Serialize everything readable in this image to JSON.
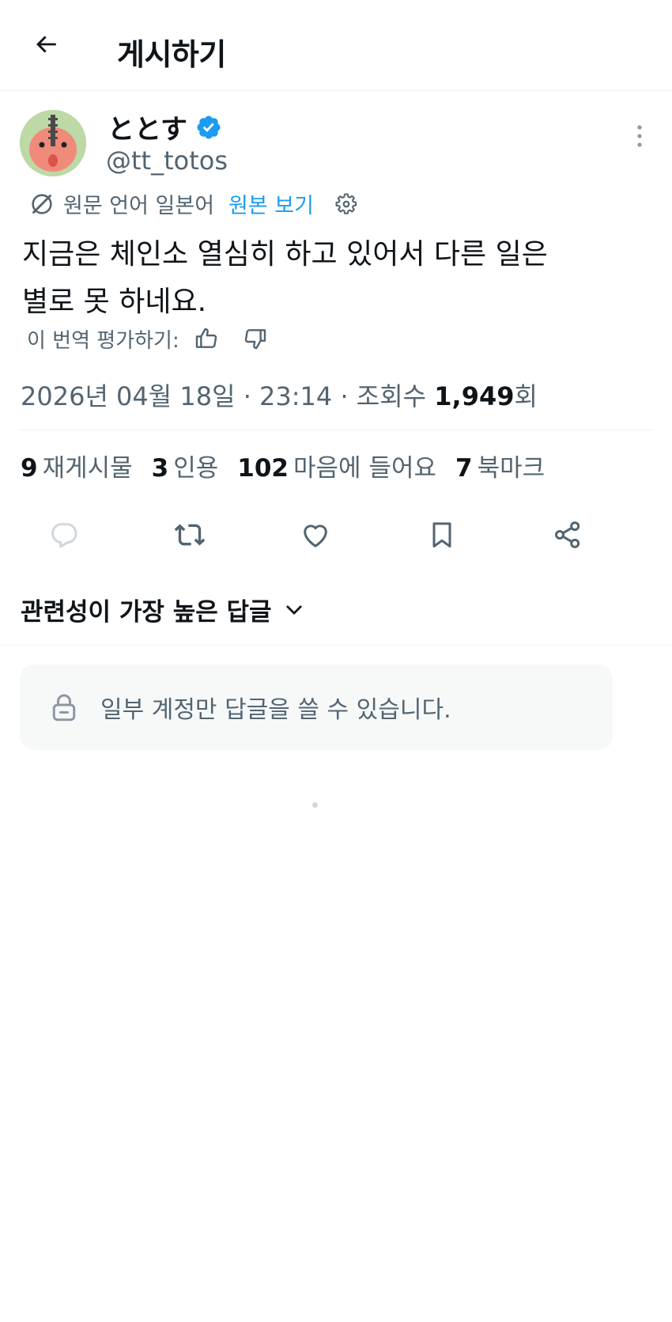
{
  "header": {
    "title": "게시하기",
    "back_icon": "arrow-left-icon"
  },
  "author": {
    "display_name": "ととす",
    "handle": "@tt_totos",
    "verified": true,
    "verified_color": "#1d9bf0"
  },
  "translation": {
    "source_label": "원문 언어 일본어",
    "view_original": "원본 보기",
    "rate_label": "이 번역 평가하기:"
  },
  "post": {
    "text_line1": "지금은 체인소 열심히 하고 있어서 다른 일은",
    "text_line2": "별로 못 하네요."
  },
  "meta": {
    "timestamp": "2026년 04월 18일 · 23:14 · 조회수 ",
    "views": "1,949",
    "views_suffix": "회"
  },
  "stats": [
    {
      "count": "9",
      "label": "재게시물"
    },
    {
      "count": "3",
      "label": "인용"
    },
    {
      "count": "102",
      "label": "마음에 들어요"
    },
    {
      "count": "7",
      "label": "북마크"
    }
  ],
  "replies": {
    "sort_label": "관련성이 가장 높은 답글",
    "restricted_message": "일부 계정만 답글을 쓸 수 있습니다."
  },
  "colors": {
    "text_primary": "#0f1419",
    "text_secondary": "#536471",
    "link": "#1d9bf0",
    "divider": "#eff3f4",
    "restrict_bg": "#f7f9f9"
  }
}
